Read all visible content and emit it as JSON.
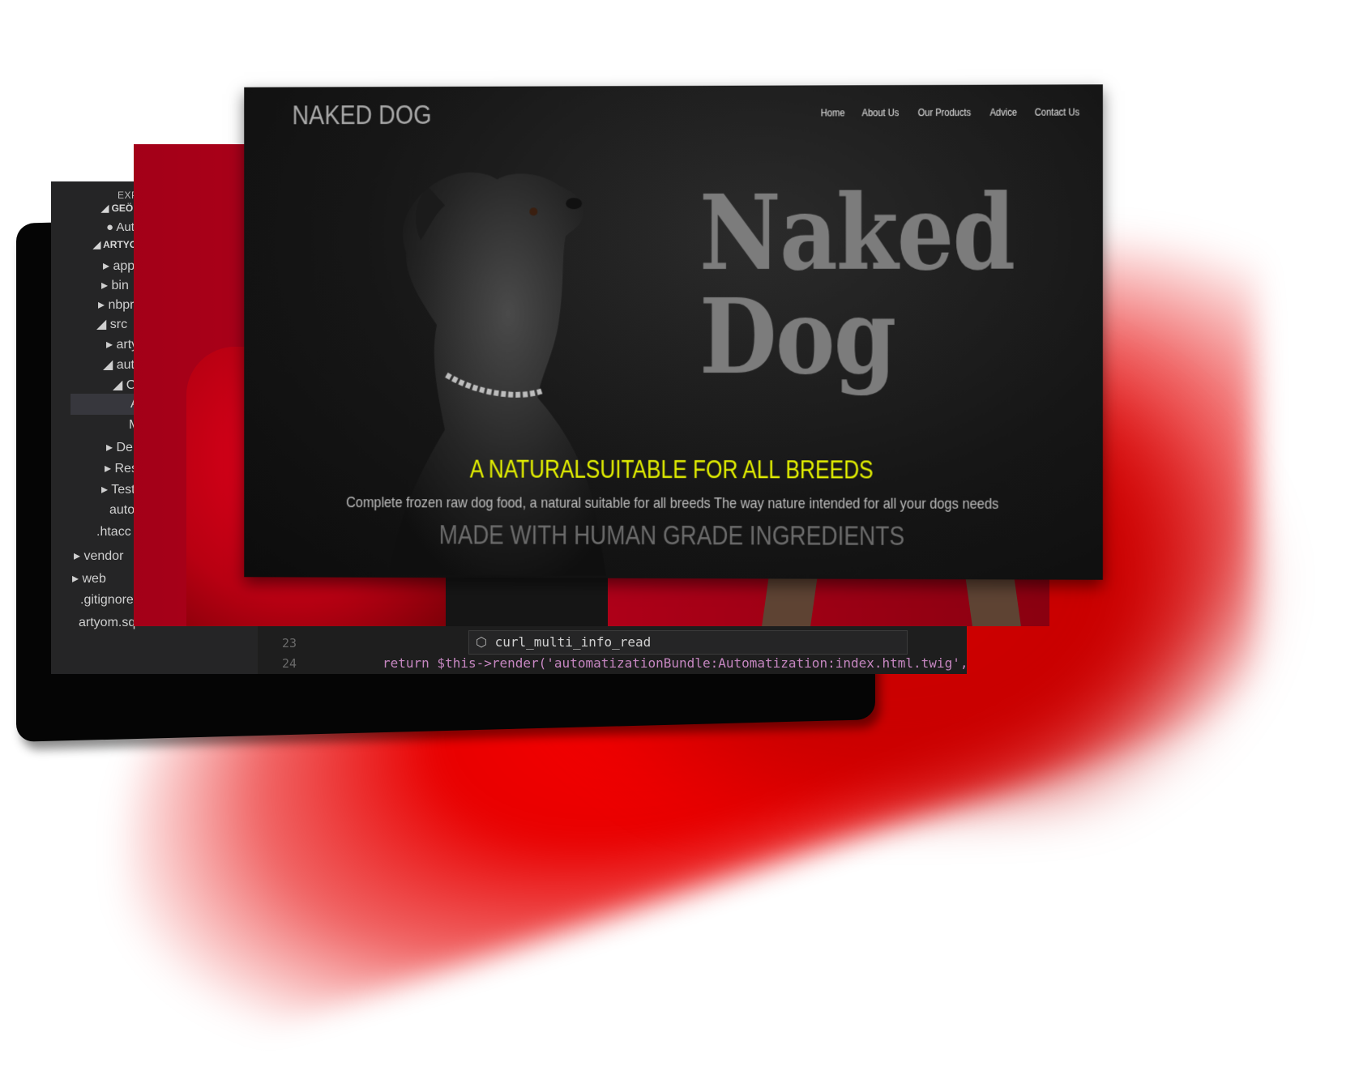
{
  "editor": {
    "explorer_title": "EXPLORER",
    "open_editors_label": "GEÖFFNETE",
    "open_file": "Automat",
    "project_label": "ARTYOM",
    "tree": [
      "app",
      "bin",
      "nbprojec",
      "src",
      "artyom",
      "autom",
      "Cont",
      "Au",
      "M",
      "Dep",
      "Reso",
      "Test",
      "auto",
      ".htacc",
      "vendor",
      "web",
      ".gitignore",
      "artyom.sql"
    ],
    "line_numbers": [
      "23",
      "24"
    ],
    "suggestion": "curl_multi_info_read",
    "code_line": "return $this->render('automatizationBundle:Automatization:index.html.twig',"
  },
  "site": {
    "brand": "NAKED DOG",
    "nav": [
      "Home",
      "About Us",
      "Our Products",
      "Advice",
      "Contact Us"
    ],
    "hero_line1": "Naked",
    "hero_line2": "Dog",
    "tagline": "A NATURALSUITABLE FOR ALL BREEDS",
    "description": "Complete frozen raw dog food, a natural suitable for all breeds The way nature intended for all your dogs needs",
    "made_with": "MADE WITH HUMAN GRADE INGREDIENTS"
  },
  "colors": {
    "accent_yellow": "#e4f000",
    "hero_gray": "#7c7c7c",
    "backdrop_red": "#e80000"
  }
}
